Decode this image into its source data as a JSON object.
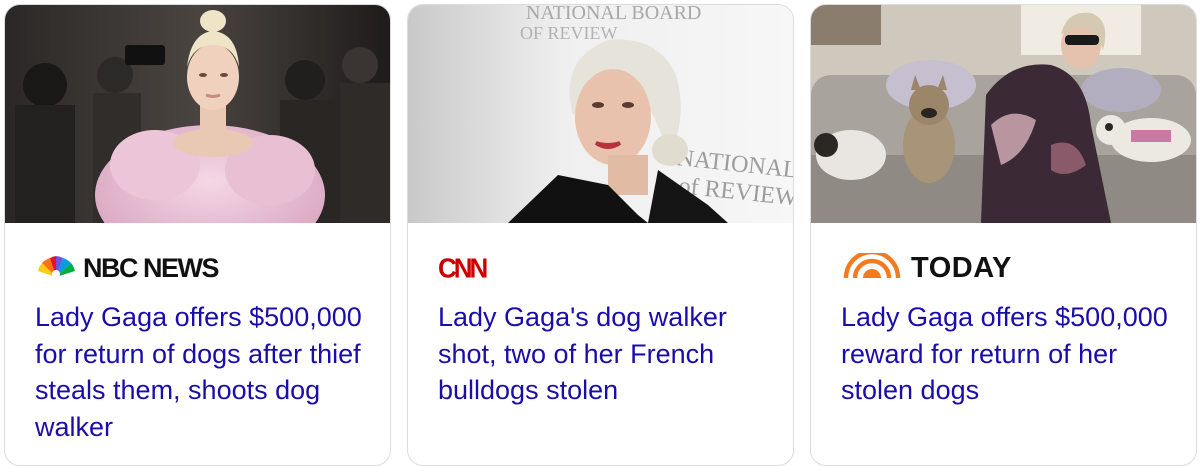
{
  "cards": [
    {
      "source": "NBC NEWS",
      "logo_icon": "nbc-peacock-icon",
      "headline": "Lady Gaga offers $500,000 for return of dogs after thief steals them, shoots dog walker",
      "image": "woman-in-pink-feather-dress-photo"
    },
    {
      "source": "CNN",
      "logo_icon": "cnn-logo",
      "headline": "Lady Gaga's dog walker shot, two of her French bulldogs stolen",
      "image": "woman-platinum-hair-black-dress-photo",
      "image_backdrop_text": [
        "NATIONAL BOARD",
        "OF REVIEW",
        "NATIONAL",
        "of REVIEW"
      ]
    },
    {
      "source": "TODAY",
      "logo_icon": "today-sunrise-icon",
      "headline": "Lady Gaga offers $500,000 reward for return of her stolen dogs",
      "image": "woman-on-couch-with-french-bulldogs-photo"
    }
  ],
  "colors": {
    "headline": "#1a0dab",
    "card_border": "#dadce0",
    "cnn_red": "#cc0000",
    "today_orange": "#f47a20"
  }
}
